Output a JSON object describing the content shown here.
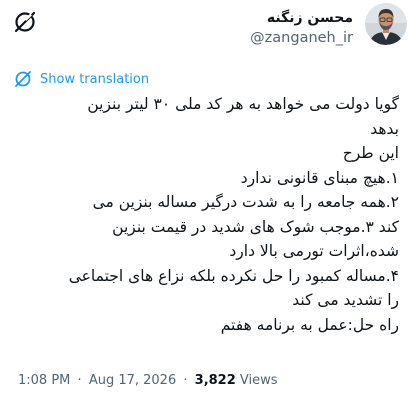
{
  "author": {
    "display_name": "محسن زنگنه",
    "handle": "@zanganeh_ir"
  },
  "translation": {
    "label": "Show translation",
    "icon": "globe-icon"
  },
  "tweet": {
    "lines": [
      "گویا دولت می خواهد به هر کد ملی ۳۰ لیتر بنزین",
      "بدهد",
      "این طرح",
      "۱.هیچ مبنای قانونی ندارد",
      "۲.همه جامعه را به شدت درگیر مساله بنزین می",
      "کند ۳.موجب شوک های شدید در قیمت بنزین",
      "شده،اثرات تورمی بالا دارد",
      "۴.مساله کمبود را حل نکرده بلکه نزاع های اجتماعی",
      "را تشدید می کند",
      "راه حل:عمل به برنامه هفتم"
    ]
  },
  "meta": {
    "time": "1:08 PM",
    "separator": "·",
    "date": "Aug 17, 2026",
    "views_count": "3,822",
    "views_label": "Views"
  },
  "colors": {
    "accent": "#1d9bf0",
    "text": "#0f1419",
    "muted": "#536471"
  }
}
